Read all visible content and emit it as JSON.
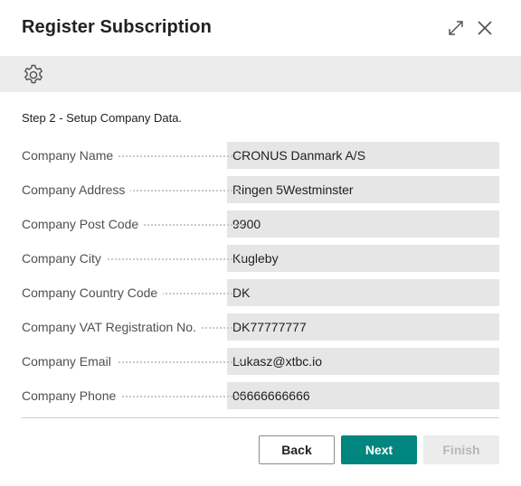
{
  "dialog": {
    "title": "Register Subscription",
    "step_text": "Step 2 - Setup Company Data.",
    "fields": [
      {
        "label": "Company Name",
        "value": "CRONUS Danmark A/S"
      },
      {
        "label": "Company Address",
        "value": "Ringen 5Westminster"
      },
      {
        "label": "Company Post Code",
        "value": "9900"
      },
      {
        "label": "Company City",
        "value": "Kugleby"
      },
      {
        "label": "Company Country Code",
        "value": "DK"
      },
      {
        "label": "Company VAT Registration No.",
        "value": "DK77777777"
      },
      {
        "label": "Company Email",
        "value": "Lukasz@xtbc.io"
      },
      {
        "label": "Company Phone",
        "value": "06666666666"
      }
    ],
    "buttons": {
      "back": "Back",
      "next": "Next",
      "finish": "Finish"
    }
  },
  "icons": {
    "expand": "expand-icon",
    "close": "close-icon",
    "settings": "gear-icon"
  },
  "colors": {
    "primary": "#00857f",
    "actionbar": "#ececec",
    "field_bg": "#e6e6e6"
  }
}
